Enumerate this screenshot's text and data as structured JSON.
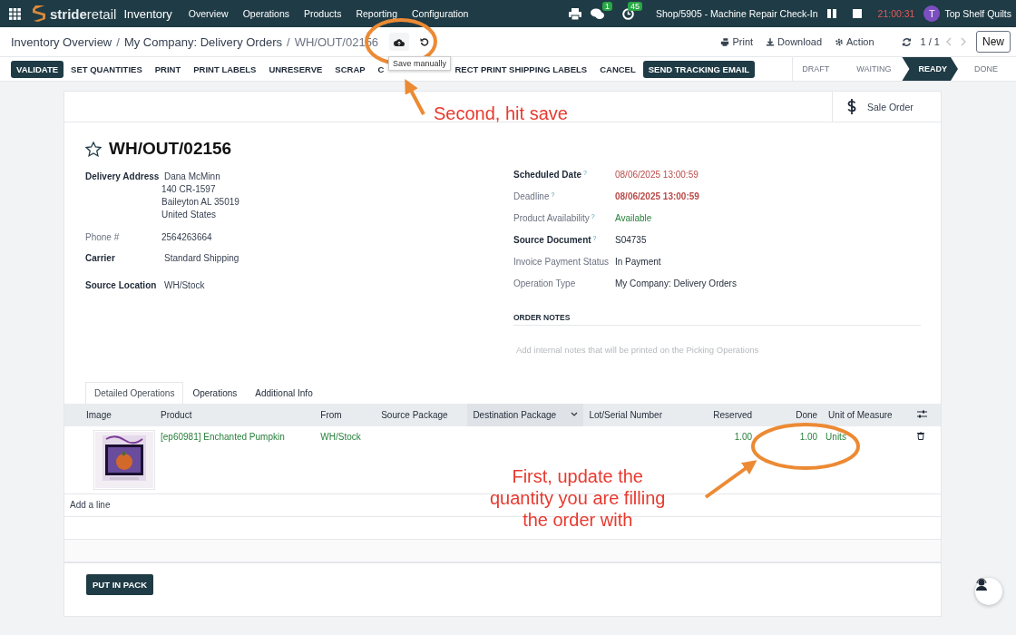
{
  "navbar": {
    "brand": "**stride**retail",
    "app": "Inventory",
    "menu": [
      "Overview",
      "Operations",
      "Products",
      "Reporting",
      "Configuration"
    ],
    "systray": {
      "chat_badge": "1",
      "activity_badge": "45",
      "session": "Shop/5905 - Machine Repair Check-In",
      "timer": "21:00:31",
      "avatar_letter": "T",
      "company": "Top Shelf Quilts"
    }
  },
  "control_panel": {
    "breadcrumbs": [
      "Inventory Overview",
      "My Company: Delivery Orders",
      "WH/OUT/02156"
    ],
    "separator": "/",
    "tooltip": "Save manually",
    "actions": [
      "Print",
      "Download",
      "Action"
    ],
    "pager": "1 / 1",
    "new_button": "New"
  },
  "action_buttons": [
    {
      "label": "VALIDATE",
      "primary": true
    },
    {
      "label": "SET QUANTITIES",
      "primary": false
    },
    {
      "label": "PRINT",
      "primary": false
    },
    {
      "label": "PRINT LABELS",
      "primary": false
    },
    {
      "label": "UNRESERVE",
      "primary": false
    },
    {
      "label": "SCRAP",
      "primary": false
    },
    {
      "label": "C",
      "primary": false
    },
    {
      "label": "RECT PRINT SHIPPING LABELS",
      "primary": false
    },
    {
      "label": "CANCEL",
      "primary": false
    },
    {
      "label": "SEND TRACKING EMAIL",
      "primary": true
    }
  ],
  "statusbar": [
    {
      "label": "DRAFT",
      "selected": false
    },
    {
      "label": "WAITING",
      "selected": false
    },
    {
      "label": "READY",
      "selected": true
    },
    {
      "label": "DONE",
      "selected": false
    }
  ],
  "smart_button": "Sale Order",
  "title": "WH/OUT/02156",
  "left_fields": [
    {
      "label": "Delivery Address",
      "required": true,
      "lines": [
        "Dana McMinn",
        "140 CR-1597",
        "Baileyton AL 35019",
        "United States"
      ]
    },
    {
      "label": "Phone #",
      "required": false,
      "lines": [
        "2564263664"
      ]
    },
    {
      "label": "Carrier",
      "required": true,
      "lines": [
        "Standard Shipping"
      ]
    },
    {
      "label": "Source Location",
      "required": true,
      "lines": [
        "WH/Stock"
      ]
    }
  ],
  "right_fields": [
    {
      "label": "Scheduled Date",
      "required": true,
      "help": "?",
      "value": "08/06/2025 13:00:59",
      "color": "#b94a48",
      "bold": false
    },
    {
      "label": "Deadline",
      "required": false,
      "help": "?",
      "value": "08/06/2025 13:00:59",
      "color": "#b94a48",
      "bold": true
    },
    {
      "label": "Product Availability",
      "required": false,
      "help": "?",
      "value": "Available",
      "color": "#28803c",
      "bold": false
    },
    {
      "label": "Source Document",
      "required": true,
      "help": "?",
      "value": "S04735",
      "bold": false
    },
    {
      "label": "Invoice Payment Status",
      "required": false,
      "value": "In Payment",
      "bold": false
    },
    {
      "label": "Operation Type",
      "required": false,
      "value": "My Company: Delivery Orders",
      "bold": false
    }
  ],
  "order_notes": {
    "heading": "ORDER NOTES",
    "placeholder": "Add internal notes that will be printed on the Picking Operations"
  },
  "tabs": [
    {
      "label": "Detailed Operations",
      "selected": true
    },
    {
      "label": "Operations",
      "selected": false
    },
    {
      "label": "Additional Info",
      "selected": false
    }
  ],
  "table": {
    "columns": [
      {
        "label": "Image",
        "numeric": false,
        "sorted": false
      },
      {
        "label": "Product",
        "numeric": false,
        "sorted": false
      },
      {
        "label": "From",
        "numeric": false,
        "sorted": false
      },
      {
        "label": "Source Package",
        "numeric": false,
        "sorted": false
      },
      {
        "label": "Destination Package",
        "numeric": false,
        "sorted": true
      },
      {
        "label": "Lot/Serial Number",
        "numeric": false,
        "sorted": false
      },
      {
        "label": "Reserved",
        "numeric": true,
        "sorted": false
      },
      {
        "label": "Done",
        "numeric": true,
        "sorted": false
      },
      {
        "label": "Unit of Measure",
        "numeric": false,
        "sorted": false
      }
    ],
    "rows": [
      {
        "product": "[ep60981] Enchanted Pumpkin",
        "from": "WH/Stock",
        "reserved": "1.00",
        "done": "1.00",
        "uom": "Units"
      }
    ],
    "add_line": "Add a line"
  },
  "footer_button": "PUT IN PACK",
  "annotations": [
    "Second, hit save",
    "First, update the\nquantity you are filling\nthe order with"
  ]
}
